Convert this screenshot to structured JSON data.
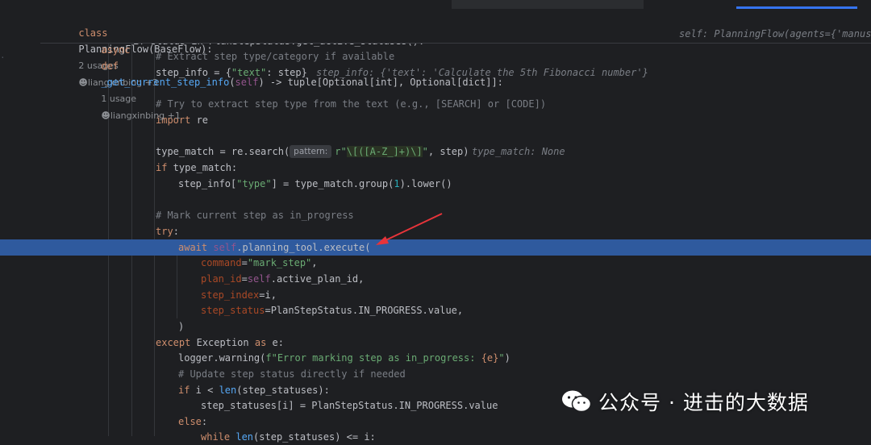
{
  "header": {
    "class_line": {
      "kw": "class",
      "name": "PlanningFlow",
      "base": "(BaseFlow):",
      "usages": "2 usages",
      "author": "liangxinbing +3"
    },
    "def_line": {
      "kw1": "async",
      "kw2": "def",
      "name": "_get_current_step_info",
      "open": "(",
      "self": "self",
      "sig_rest": ") -> tuple[Optional[int], Optional[dict]]:",
      "usages": "1 usage",
      "author": "liangxinbing +1",
      "hint": "self: PlanningFlow(agents={'manus'"
    }
  },
  "code": {
    "l0": "if status in PlanStepStatus.get_active_statuses():",
    "l1": "# Extract step type/category if available",
    "l2a": "step_info = {",
    "l2b": "\"text\"",
    "l2c": ": step}",
    "l2hint": "step_info: {'text': 'Calculate the 5th Fibonacci number'}",
    "l4": "# Try to extract step type from the text (e.g., [SEARCH] or [CODE])",
    "l5kw": "import",
    "l5": " re",
    "l7a": "type_match = re.search(",
    "l7pill": "pattern:",
    "l7str1": "r\"",
    "l7regex": "\\[([A-Z_]+)\\]",
    "l7str2": "\"",
    "l7c": ", step)",
    "l7hint": "type_match: None",
    "l8kw": "if",
    "l8": " type_match:",
    "l9a": "step_info[",
    "l9b": "\"type\"",
    "l9c": "] = type_match.group(",
    "l9num": "1",
    "l9d": ").lower()",
    "l11": "# Mark current step as in_progress",
    "l12kw": "try",
    "l12": ":",
    "l13kw": "await",
    "l13self": "self",
    "l13a": ".planning_tool.execute(",
    "l14p": "command",
    "l14eq": "=",
    "l14s": "\"mark_step\"",
    "l14c": ",",
    "l15p": "plan_id",
    "l15eq": "=",
    "l15self": "self",
    "l15a": ".active_plan_id,",
    "l16p": "step_index",
    "l16a": "=i,",
    "l17p": "step_status",
    "l17a": "=PlanStepStatus.IN_PROGRESS.value,",
    "l18": ")",
    "l19kw": "except",
    "l19cls": "Exception",
    "l19kw2": "as",
    "l19": " e:",
    "l20a": "logger.warning(",
    "l20s": "f\"Error marking step as in_progress: ",
    "l20b": "{e}",
    "l20s2": "\"",
    "l20c": ")",
    "l21": "# Update step status directly if needed",
    "l22kw": "if",
    "l22a": " i < ",
    "l22fn": "len",
    "l22b": "(step_statuses):",
    "l23": "step_statuses[i] = PlanStepStatus.IN_PROGRESS.value",
    "l24kw": "else",
    "l24": ":",
    "l25kw": "while",
    "l25a": " ",
    "l25fn": "len",
    "l25b": "(step_statuses) <= i:"
  },
  "watermark": {
    "text": "公众号 · 进击的大数据"
  },
  "colors": {
    "highlight": "#2f5a9e",
    "keyword": "#cf8e6d",
    "string": "#6aab73",
    "function": "#56a8f5",
    "arrow": "#e8343a"
  }
}
